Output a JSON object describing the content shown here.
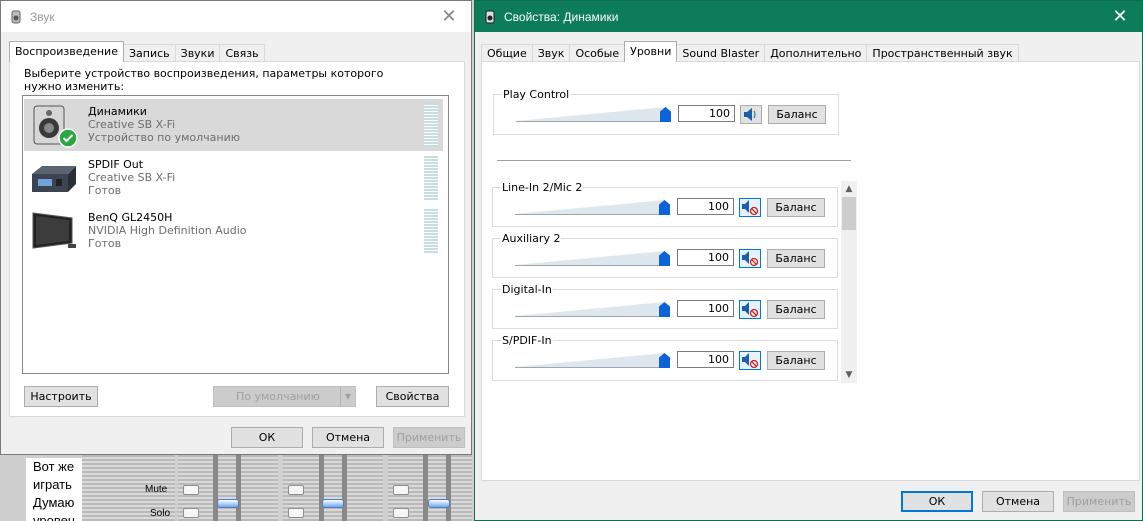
{
  "background_app": {
    "text_lines": [
      "Вот же",
      "играть",
      "Думаю",
      "уровен"
    ],
    "mute_label": "Mute",
    "solo_label": "Solo"
  },
  "sound_window": {
    "title": "Звук",
    "tabs": [
      "Воспроизведение",
      "Запись",
      "Звуки",
      "Связь"
    ],
    "active_tab": 0,
    "instruction": "Выберите устройство воспроизведения, параметры которого нужно изменить:",
    "devices": [
      {
        "name": "Динамики",
        "line2": "Creative SB X-Fi",
        "line3": "Устройство по умолчанию",
        "selected": true
      },
      {
        "name": "SPDIF Out",
        "line2": "Creative SB X-Fi",
        "line3": "Готов",
        "selected": false
      },
      {
        "name": "BenQ GL2450H",
        "line2": "NVIDIA High Definition Audio",
        "line3": "Готов",
        "selected": false
      }
    ],
    "configure_label": "Настроить",
    "default_label": "По умолчанию",
    "properties_label": "Свойства",
    "ok_label": "ОК",
    "cancel_label": "Отмена",
    "apply_label": "Применить"
  },
  "props_window": {
    "title": "Свойства: Динамики",
    "tabs": [
      "Общие",
      "Звук",
      "Особые",
      "Уровни",
      "Sound Blaster",
      "Дополнительно",
      "Пространственный звук"
    ],
    "active_tab": 3,
    "levels": [
      {
        "label": "Play Control",
        "value": "100",
        "muted": false,
        "balance": "Баланс"
      },
      {
        "label": "Line-In 2/Mic 2",
        "value": "100",
        "muted": true,
        "balance": "Баланс"
      },
      {
        "label": "Auxiliary 2",
        "value": "100",
        "muted": true,
        "balance": "Баланс"
      },
      {
        "label": "Digital-In",
        "value": "100",
        "muted": true,
        "balance": "Баланс"
      },
      {
        "label": "S/PDIF-In",
        "value": "100",
        "muted": true,
        "balance": "Баланс"
      }
    ],
    "ok_label": "ОК",
    "cancel_label": "Отмена",
    "apply_label": "Применить"
  },
  "colors": {
    "accent": "#0078d7",
    "slider_thumb": "#0a64d8",
    "props_title_bar": "#ffffff",
    "selected_row": "#d9d9d9",
    "default_check": "#2aa841"
  }
}
